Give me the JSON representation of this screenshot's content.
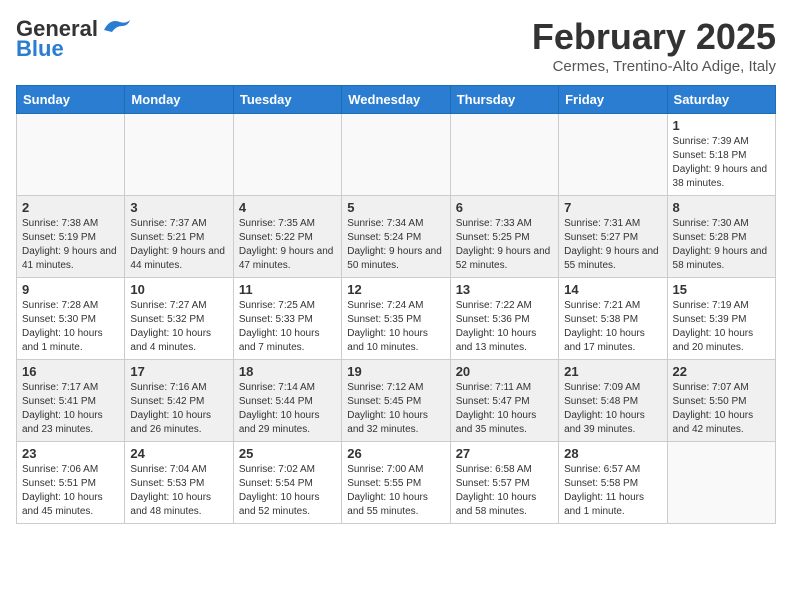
{
  "header": {
    "logo_general": "General",
    "logo_blue": "Blue",
    "month_year": "February 2025",
    "location": "Cermes, Trentino-Alto Adige, Italy"
  },
  "days_of_week": [
    "Sunday",
    "Monday",
    "Tuesday",
    "Wednesday",
    "Thursday",
    "Friday",
    "Saturday"
  ],
  "weeks": [
    [
      {
        "day": "",
        "info": ""
      },
      {
        "day": "",
        "info": ""
      },
      {
        "day": "",
        "info": ""
      },
      {
        "day": "",
        "info": ""
      },
      {
        "day": "",
        "info": ""
      },
      {
        "day": "",
        "info": ""
      },
      {
        "day": "1",
        "info": "Sunrise: 7:39 AM\nSunset: 5:18 PM\nDaylight: 9 hours and 38 minutes."
      }
    ],
    [
      {
        "day": "2",
        "info": "Sunrise: 7:38 AM\nSunset: 5:19 PM\nDaylight: 9 hours and 41 minutes."
      },
      {
        "day": "3",
        "info": "Sunrise: 7:37 AM\nSunset: 5:21 PM\nDaylight: 9 hours and 44 minutes."
      },
      {
        "day": "4",
        "info": "Sunrise: 7:35 AM\nSunset: 5:22 PM\nDaylight: 9 hours and 47 minutes."
      },
      {
        "day": "5",
        "info": "Sunrise: 7:34 AM\nSunset: 5:24 PM\nDaylight: 9 hours and 50 minutes."
      },
      {
        "day": "6",
        "info": "Sunrise: 7:33 AM\nSunset: 5:25 PM\nDaylight: 9 hours and 52 minutes."
      },
      {
        "day": "7",
        "info": "Sunrise: 7:31 AM\nSunset: 5:27 PM\nDaylight: 9 hours and 55 minutes."
      },
      {
        "day": "8",
        "info": "Sunrise: 7:30 AM\nSunset: 5:28 PM\nDaylight: 9 hours and 58 minutes."
      }
    ],
    [
      {
        "day": "9",
        "info": "Sunrise: 7:28 AM\nSunset: 5:30 PM\nDaylight: 10 hours and 1 minute."
      },
      {
        "day": "10",
        "info": "Sunrise: 7:27 AM\nSunset: 5:32 PM\nDaylight: 10 hours and 4 minutes."
      },
      {
        "day": "11",
        "info": "Sunrise: 7:25 AM\nSunset: 5:33 PM\nDaylight: 10 hours and 7 minutes."
      },
      {
        "day": "12",
        "info": "Sunrise: 7:24 AM\nSunset: 5:35 PM\nDaylight: 10 hours and 10 minutes."
      },
      {
        "day": "13",
        "info": "Sunrise: 7:22 AM\nSunset: 5:36 PM\nDaylight: 10 hours and 13 minutes."
      },
      {
        "day": "14",
        "info": "Sunrise: 7:21 AM\nSunset: 5:38 PM\nDaylight: 10 hours and 17 minutes."
      },
      {
        "day": "15",
        "info": "Sunrise: 7:19 AM\nSunset: 5:39 PM\nDaylight: 10 hours and 20 minutes."
      }
    ],
    [
      {
        "day": "16",
        "info": "Sunrise: 7:17 AM\nSunset: 5:41 PM\nDaylight: 10 hours and 23 minutes."
      },
      {
        "day": "17",
        "info": "Sunrise: 7:16 AM\nSunset: 5:42 PM\nDaylight: 10 hours and 26 minutes."
      },
      {
        "day": "18",
        "info": "Sunrise: 7:14 AM\nSunset: 5:44 PM\nDaylight: 10 hours and 29 minutes."
      },
      {
        "day": "19",
        "info": "Sunrise: 7:12 AM\nSunset: 5:45 PM\nDaylight: 10 hours and 32 minutes."
      },
      {
        "day": "20",
        "info": "Sunrise: 7:11 AM\nSunset: 5:47 PM\nDaylight: 10 hours and 35 minutes."
      },
      {
        "day": "21",
        "info": "Sunrise: 7:09 AM\nSunset: 5:48 PM\nDaylight: 10 hours and 39 minutes."
      },
      {
        "day": "22",
        "info": "Sunrise: 7:07 AM\nSunset: 5:50 PM\nDaylight: 10 hours and 42 minutes."
      }
    ],
    [
      {
        "day": "23",
        "info": "Sunrise: 7:06 AM\nSunset: 5:51 PM\nDaylight: 10 hours and 45 minutes."
      },
      {
        "day": "24",
        "info": "Sunrise: 7:04 AM\nSunset: 5:53 PM\nDaylight: 10 hours and 48 minutes."
      },
      {
        "day": "25",
        "info": "Sunrise: 7:02 AM\nSunset: 5:54 PM\nDaylight: 10 hours and 52 minutes."
      },
      {
        "day": "26",
        "info": "Sunrise: 7:00 AM\nSunset: 5:55 PM\nDaylight: 10 hours and 55 minutes."
      },
      {
        "day": "27",
        "info": "Sunrise: 6:58 AM\nSunset: 5:57 PM\nDaylight: 10 hours and 58 minutes."
      },
      {
        "day": "28",
        "info": "Sunrise: 6:57 AM\nSunset: 5:58 PM\nDaylight: 11 hours and 1 minute."
      },
      {
        "day": "",
        "info": ""
      }
    ]
  ]
}
